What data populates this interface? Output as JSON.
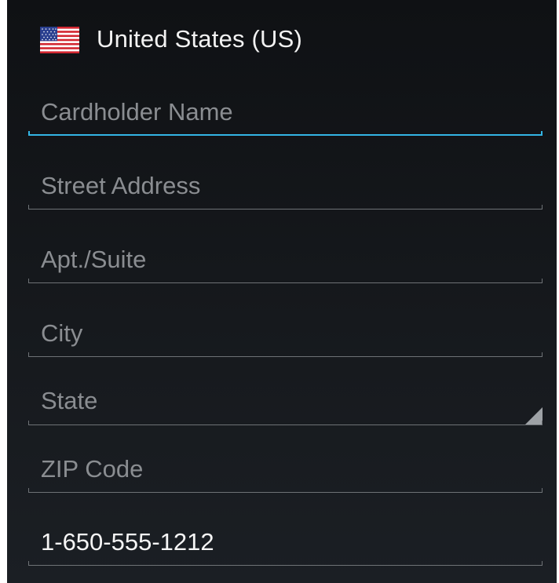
{
  "country": {
    "label": "United States (US)",
    "flag_icon": "us-flag-icon"
  },
  "form": {
    "cardholder_name": {
      "placeholder": "Cardholder Name",
      "value": ""
    },
    "street_address": {
      "placeholder": "Street Address",
      "value": ""
    },
    "apt_suite": {
      "placeholder": "Apt./Suite",
      "value": ""
    },
    "city": {
      "placeholder": "City",
      "value": ""
    },
    "state": {
      "placeholder": "State",
      "value": ""
    },
    "zip_code": {
      "placeholder": "ZIP Code",
      "value": ""
    },
    "phone": {
      "placeholder": "",
      "value": "1-650-555-1212"
    }
  },
  "colors": {
    "background": "#16191d",
    "focus_accent": "#33b5e5",
    "hint_text": "#8a8d91",
    "value_text": "#f5f5f5"
  }
}
